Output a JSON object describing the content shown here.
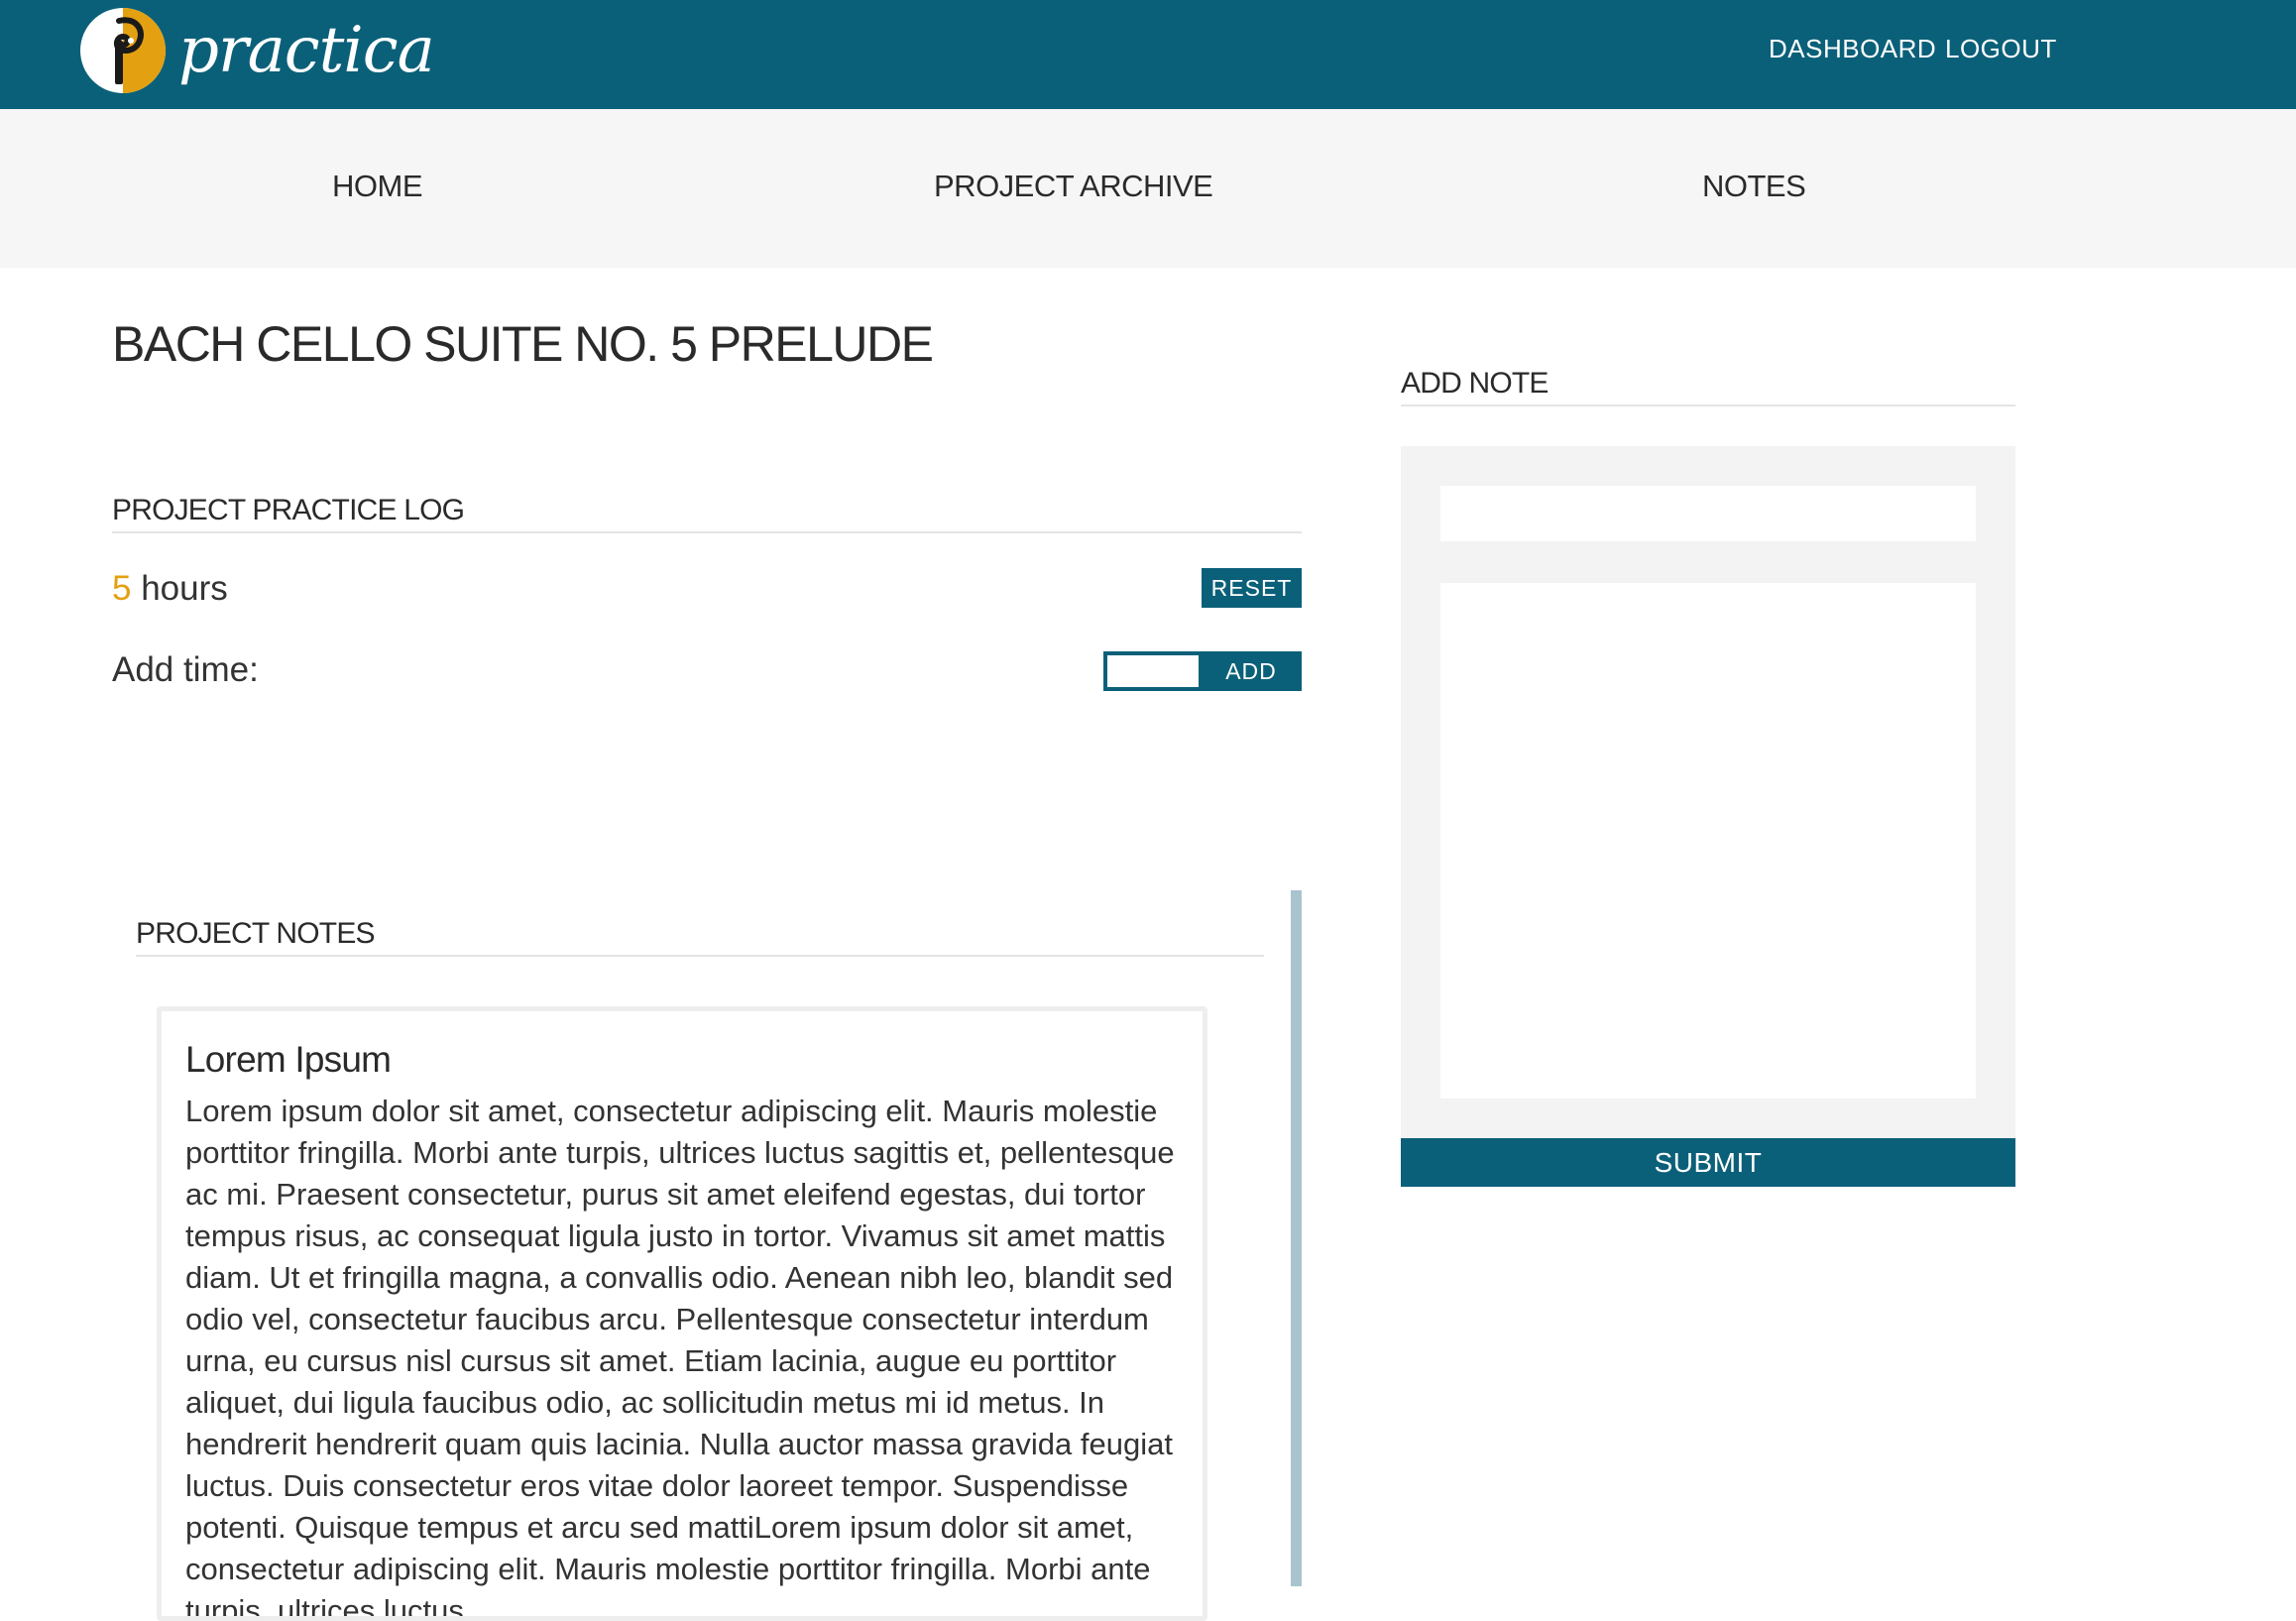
{
  "app": {
    "name": "practica",
    "colors": {
      "primary": "#0b6079",
      "accent": "#e3a010",
      "nav_bg": "#f6f6f6",
      "panel_bg": "#f3f3f3"
    },
    "logo_icon": "practica-logo-icon"
  },
  "header": {
    "links": {
      "dashboard": "DASHBOARD",
      "logout": "LOGOUT"
    }
  },
  "nav": {
    "home": "HOME",
    "archive": "PROJECT ARCHIVE",
    "notes": "NOTES"
  },
  "project": {
    "title": "BACH CELLO SUITE NO. 5 PRELUDE"
  },
  "practice_log": {
    "heading": "PROJECT PRACTICE LOG",
    "hours_value": "5",
    "hours_unit": "hours",
    "reset_label": "RESET",
    "add_time_label": "Add time:",
    "add_time_value": "",
    "add_label": "ADD"
  },
  "project_notes": {
    "heading": "PROJECT NOTES",
    "notes": [
      {
        "title": "Lorem Ipsum",
        "body": "Lorem ipsum dolor sit amet, consectetur adipiscing elit. Mauris molestie porttitor fringilla. Morbi ante turpis, ultrices luctus sagittis et, pellentesque ac mi. Praesent consectetur, purus sit amet eleifend egestas, dui tortor tempus risus, ac consequat ligula justo in tortor. Vivamus sit amet mattis diam. Ut et fringilla magna, a convallis odio. Aenean nibh leo, blandit sed odio vel, consectetur faucibus arcu. Pellentesque consectetur interdum urna, eu cursus nisl cursus sit amet. Etiam lacinia, augue eu porttitor aliquet, dui ligula faucibus odio, ac sollicitudin metus mi id metus. In hendrerit hendrerit quam quis lacinia. Nulla auctor massa gravida feugiat luctus. Duis consectetur eros vitae dolor laoreet tempor. Suspendisse potenti. Quisque tempus et arcu sed mattiLorem ipsum dolor sit amet, consectetur adipiscing elit. Mauris molestie porttitor fringilla. Morbi ante turpis, ultrices luctus"
      }
    ]
  },
  "add_note": {
    "heading": "ADD NOTE",
    "title_value": "",
    "body_value": "",
    "submit_label": "SUBMIT"
  }
}
